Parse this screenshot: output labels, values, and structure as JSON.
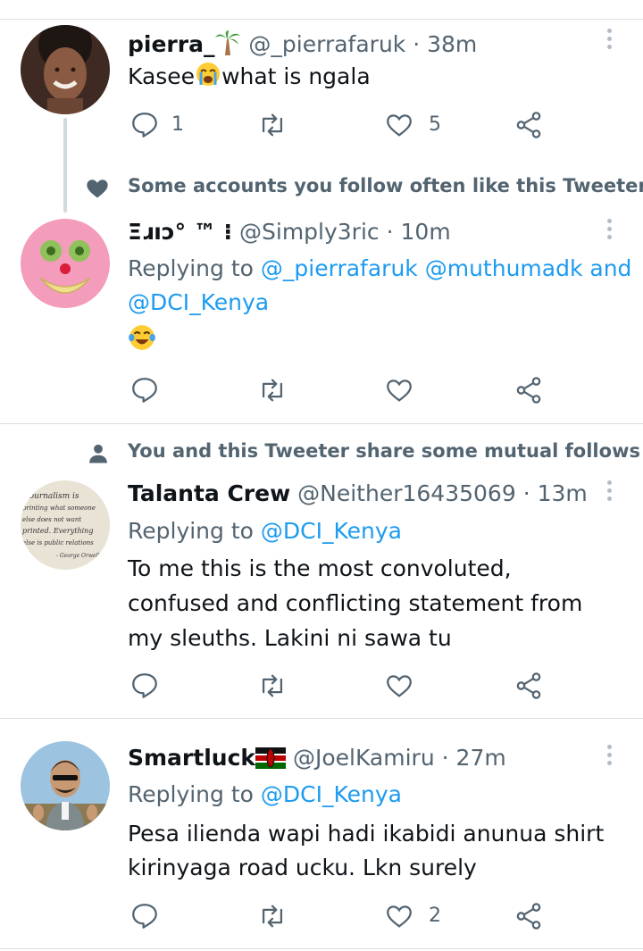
{
  "colors": {
    "text_primary": "#0f1419",
    "text_secondary": "#536471",
    "link": "#1d9bf0",
    "divider": "#d9dde1"
  },
  "tweets": [
    {
      "display_name": "pierra_",
      "name_emoji": "palm-tree",
      "handle": "@_pierrafaruk",
      "separator": "·",
      "time": "38m",
      "text_before_emoji": "Kasee",
      "text_emoji": "crying-face",
      "text_after_emoji": "what is ngala",
      "reply_count": "1",
      "like_count": "5"
    },
    {
      "context_icon": "heart-icon",
      "context_text": "Some accounts you follow often like this Tweeter",
      "display_name": "Ξɹıɔ° ™ ⁝",
      "handle": "@Simply3ric",
      "separator": "·",
      "time": "10m",
      "replying_label": "Replying to",
      "replying_mentions": [
        "@_pierrafaruk",
        "@muthumadk",
        "and",
        "@DCI_Kenya"
      ],
      "text_emoji": "tears-of-joy"
    },
    {
      "context_icon": "person-icon",
      "context_text": "You and this Tweeter share some mutual follows",
      "display_name": "Talanta Crew",
      "handle": "@Neither16435069",
      "separator": "·",
      "time": "13m",
      "replying_label": "Replying to",
      "replying_mentions": [
        "@DCI_Kenya"
      ],
      "text_lines": [
        "To me this is the most convoluted,",
        "confused and conflicting statement from",
        "my sleuths. Lakini ni sawa tu"
      ],
      "avatar_text": [
        "Journalism is",
        "printing what someone",
        "else does not want",
        "printed. Everything",
        "else is public relations",
        "- George Orwell"
      ]
    },
    {
      "display_name": "Smartluck",
      "name_emoji": "kenya-flag",
      "handle": "@JoelKamiru",
      "separator": "·",
      "time": "27m",
      "replying_label": "Replying to",
      "replying_mentions": [
        "@DCI_Kenya"
      ],
      "text_lines": [
        "Pesa ilienda wapi hadi ikabidi anunua shirt",
        "kirinyaga road ucku. Lkn surely"
      ],
      "like_count": "2"
    }
  ]
}
